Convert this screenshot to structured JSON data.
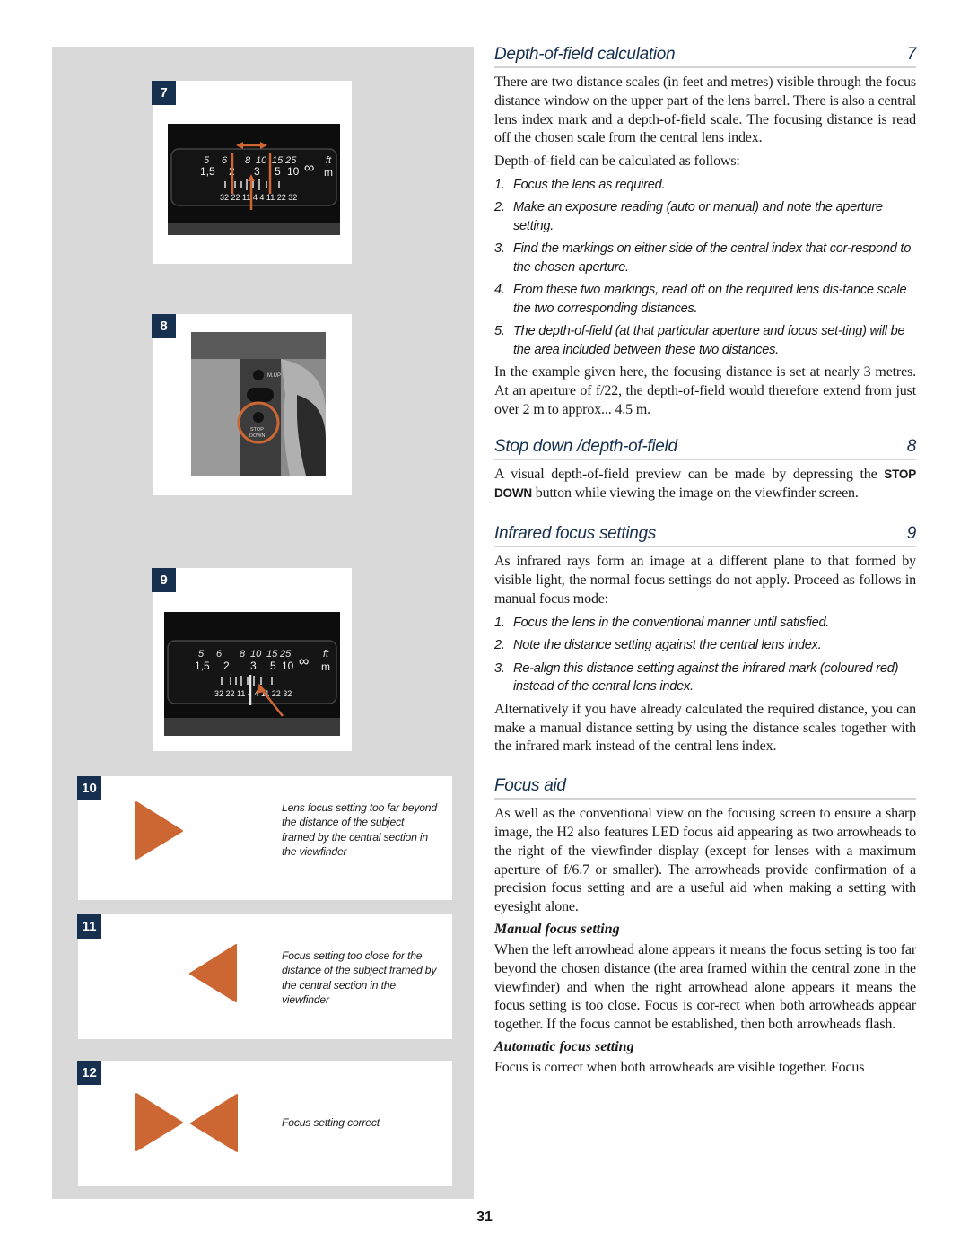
{
  "figures": [
    {
      "number": "7",
      "type": "photo",
      "alt": "Lens distance scale with depth-of-field markers"
    },
    {
      "number": "8",
      "type": "photo",
      "alt": "Camera body showing STOP DOWN button"
    },
    {
      "number": "9",
      "type": "photo",
      "alt": "Lens distance scale with infrared mark"
    },
    {
      "number": "10",
      "type": "arrow-diagram",
      "arrows": [
        "right"
      ],
      "caption": "Lens focus setting too far beyond the distance of the subject framed by the central section in the viewfinder"
    },
    {
      "number": "11",
      "type": "arrow-diagram",
      "arrows": [
        "left"
      ],
      "caption": "Focus setting too close for the distance of the subject framed by the central section in the viewfinder"
    },
    {
      "number": "12",
      "type": "arrow-diagram",
      "arrows": [
        "right",
        "left"
      ],
      "caption": "Focus setting correct"
    }
  ],
  "photo_labels": {
    "scale_ft": [
      "5",
      "6",
      "8",
      "10",
      "15",
      "25",
      "∞",
      "ft"
    ],
    "scale_m": [
      "1,5",
      "2",
      "3",
      "5",
      "10",
      "m"
    ],
    "dof_scale": "32 22 11 4 4 11 22 32",
    "button_top": "M.UP",
    "button_bottom_1": "STOP",
    "button_bottom_2": "DOWN"
  },
  "colors": {
    "accent": "#cc6633",
    "badge": "#17304f",
    "heading": "#17304f",
    "panel": "#d9d9d9"
  },
  "sections": {
    "dof": {
      "title": "Depth-of-field calculation",
      "fig": "7",
      "intro": "There are two distance scales (in feet and metres) visible through the focus distance window on the upper part of the lens barrel. There is also a central lens index mark and a depth-of-field scale. The focusing distance is read off the chosen scale from the central lens index.",
      "lead": "Depth-of-field can be calculated as follows:",
      "steps": [
        "Focus the lens as required.",
        "Make an exposure reading (auto or manual) and note the aperture setting.",
        "Find the markings on either side of the central index that cor-respond to the chosen aperture.",
        "From these two markings, read off on the required lens dis-tance scale the two corresponding distances.",
        "The depth-of-field (at that particular aperture and focus set-ting) will be the area included between these two distances."
      ],
      "example": "In the example given here, the focusing distance is set at nearly 3 metres. At an aperture of f/22, the depth-of-field would therefore extend from just over 2 m to approx... 4.5 m."
    },
    "stopdown": {
      "title": "Stop down /depth-of-field",
      "fig": "8",
      "text_before": "A visual depth-of-field preview can be made by depressing the ",
      "button_name": "STOP DOWN",
      "text_after": " button while viewing the image on the viewfinder screen."
    },
    "infrared": {
      "title": "Infrared focus settings",
      "fig": "9",
      "intro": "As infrared rays form an image at a different plane to that formed by visible light, the normal focus settings do not apply. Proceed as follows in manual focus mode:",
      "steps": [
        "Focus the lens in the conventional manner until satisfied.",
        "Note the distance setting against the central lens index.",
        "Re-align this distance setting against the infrared mark (coloured red) instead of the central lens index."
      ],
      "outro": "Alternatively if you have already calculated the required distance, you can make a manual distance setting by using the distance scales together with the infrared mark instead of the central lens index."
    },
    "focusaid": {
      "title": "Focus aid",
      "intro": "As well as the conventional view on the focusing screen to ensure a sharp image, the H2 also features LED focus aid appearing as two arrowheads to the right of the viewfinder display (except for lenses with a maximum aperture of f/6.7 or smaller). The arrowheads provide confirmation of a precision focus setting and are a useful aid when making a setting with eyesight alone.",
      "manual_title": "Manual focus setting",
      "manual_text": "When the left arrowhead alone appears it means the focus setting is too far beyond the chosen distance (the area framed within the central zone in the viewfinder) and when the right arrowhead alone appears it means the focus setting is too close. Focus is cor-rect when both arrowheads appear together. If the focus cannot be established, then both arrowheads flash.",
      "auto_title": "Automatic focus setting",
      "auto_text": "Focus is correct when both arrowheads are visible together. Focus"
    }
  },
  "page_number": "31"
}
